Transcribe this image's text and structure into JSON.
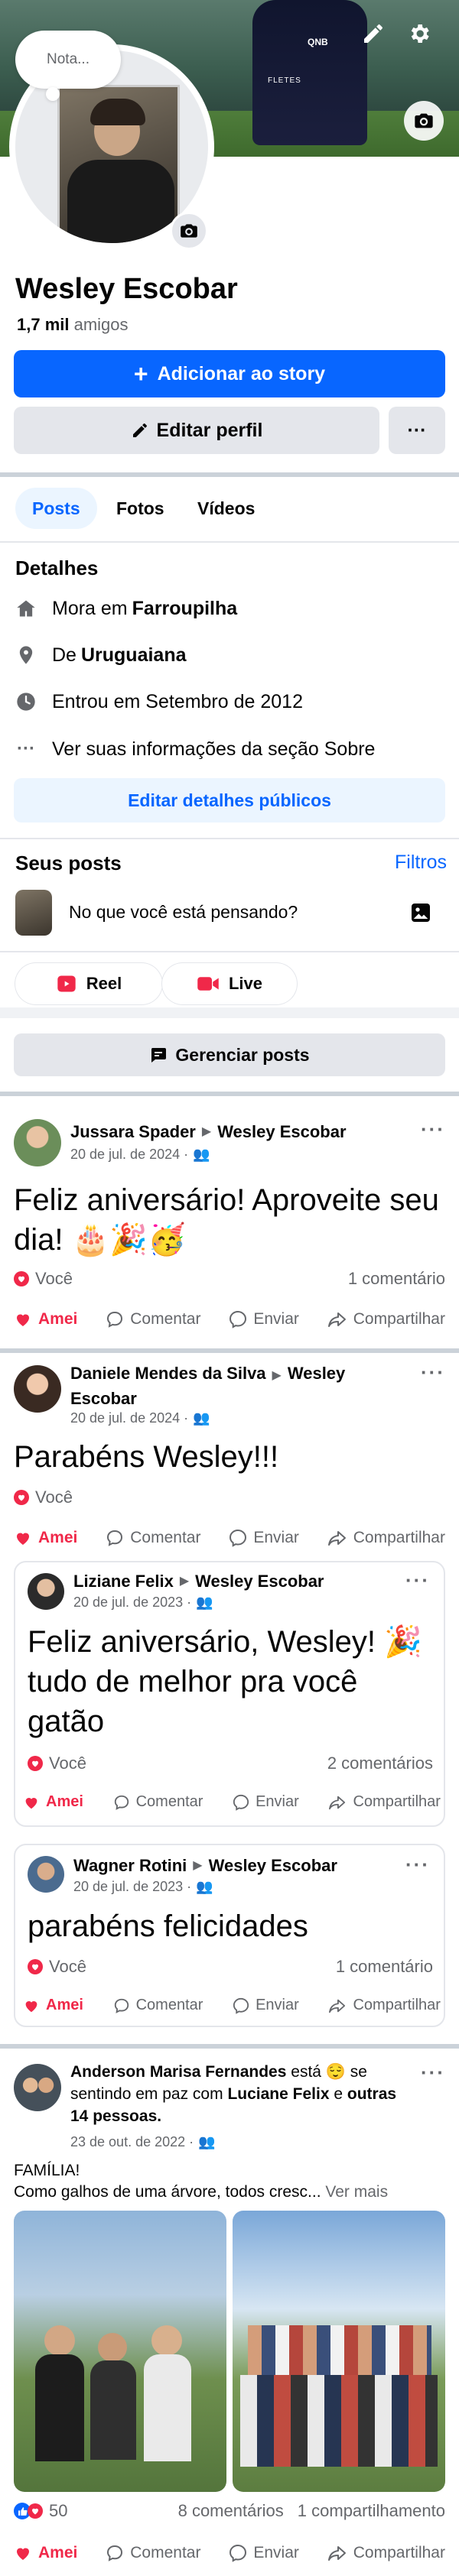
{
  "profile": {
    "note_placeholder": "Nota...",
    "name": "Wesley Escobar",
    "friends_count": "1,7 mil",
    "friends_label": "amigos",
    "add_story_label": "Adicionar ao story",
    "edit_profile_label": "Editar perfil",
    "more_label": "···"
  },
  "tabs": [
    {
      "label": "Posts",
      "active": true
    },
    {
      "label": "Fotos",
      "active": false
    },
    {
      "label": "Vídeos",
      "active": false
    }
  ],
  "details": {
    "title": "Detalhes",
    "lives_prefix": "Mora em",
    "lives_city": "Farroupilha",
    "from_prefix": "De",
    "from_city": "Uruguaiana",
    "joined": "Entrou em Setembro de 2012",
    "see_about": "Ver suas informações da seção Sobre",
    "edit_public_label": "Editar detalhes públicos"
  },
  "your_posts": {
    "title": "Seus posts",
    "filters_label": "Filtros",
    "composer_placeholder": "No que você está pensando?",
    "reel_label": "Reel",
    "live_label": "Live",
    "manage_label": "Gerenciar posts"
  },
  "posts": [
    {
      "author": "Jussara Spader",
      "target": "Wesley Escobar",
      "date": "20 de jul. de 2024 ·",
      "text": "Feliz aniversário! Aproveite seu dia! 🎂🎉🥳",
      "reactor": "Você",
      "comments": "1 comentário"
    },
    {
      "author": "Daniele Mendes da Silva",
      "target": "Wesley Escobar",
      "date": "20 de jul. de 2024 ·",
      "text": "Parabéns Wesley!!!",
      "reactor": "Você"
    },
    {
      "author": "Liziane Felix",
      "target": "Wesley Escobar",
      "date": "20 de jul. de 2023 ·",
      "text": "Feliz aniversário, Wesley! 🎉tudo de melhor pra você gatão",
      "reactor": "Você",
      "comments": "2 comentários"
    },
    {
      "author": "Wagner Rotini",
      "target": "Wesley Escobar",
      "date": "20 de jul. de 2023 ·",
      "text": "parabéns felicidades",
      "reactor": "Você",
      "comments": "1 comentário"
    },
    {
      "author": "Anderson Marisa Fernandes",
      "feeling_prefix": "está 😌 se sentindo em paz com",
      "tagged": "Luciane Felix",
      "tagged_suffix": "e",
      "others": "outras 14 pessoas.",
      "date": "23 de out. de 2022 ·",
      "text_line1": "FAMÍLIA!",
      "text_line2": "Como galhos de uma árvore, todos cresc...",
      "see_more": "Ver mais",
      "reaction_count": "50",
      "comments": "8 comentários",
      "shares": "1 compartilhamento"
    }
  ],
  "actions": {
    "love": "Amei",
    "comment": "Comentar",
    "send": "Enviar",
    "share": "Compartilhar"
  },
  "colors": {
    "primary": "#0866ff",
    "love": "#f02849",
    "gray_text": "#65676b"
  }
}
